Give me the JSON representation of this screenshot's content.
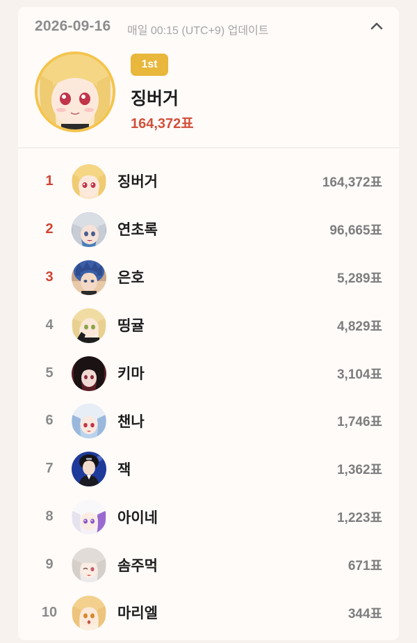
{
  "header": {
    "date": "2026-09-16",
    "update_note": "매일 00:15 (UTC+9) 업데이트"
  },
  "winner": {
    "badge": "1st",
    "name": "징버거",
    "votes": "164,372표"
  },
  "colors": {
    "accent_red": "#d0442f",
    "badge_gold": "#e8b73b",
    "card_bg": "#fffbf9",
    "page_bg": "#f8f2ee"
  },
  "ranking": [
    {
      "rank": "1",
      "name": "징버거",
      "votes": "164,372표",
      "avatar": "blonde-girl-avatar"
    },
    {
      "rank": "2",
      "name": "연초록",
      "votes": "96,665표",
      "avatar": "silver-hair-girl-avatar"
    },
    {
      "rank": "3",
      "name": "은호",
      "votes": "5,289표",
      "avatar": "blue-hair-boy-avatar"
    },
    {
      "rank": "4",
      "name": "띵귤",
      "votes": "4,829표",
      "avatar": "blonde-waving-girl-avatar"
    },
    {
      "rank": "5",
      "name": "키마",
      "votes": "3,104표",
      "avatar": "dark-hair-girl-avatar"
    },
    {
      "rank": "6",
      "name": "챈나",
      "votes": "1,746표",
      "avatar": "blue-white-hair-girl-avatar"
    },
    {
      "rank": "7",
      "name": "잭",
      "votes": "1,362표",
      "avatar": "black-hair-boy-avatar"
    },
    {
      "rank": "8",
      "name": "아이네",
      "votes": "1,223표",
      "avatar": "white-hair-purple-eye-avatar"
    },
    {
      "rank": "9",
      "name": "솜주먹",
      "votes": "671표",
      "avatar": "white-hair-winking-girl-avatar"
    },
    {
      "rank": "10",
      "name": "마리엘",
      "votes": "344표",
      "avatar": "blonde-surprised-girl-avatar"
    }
  ]
}
